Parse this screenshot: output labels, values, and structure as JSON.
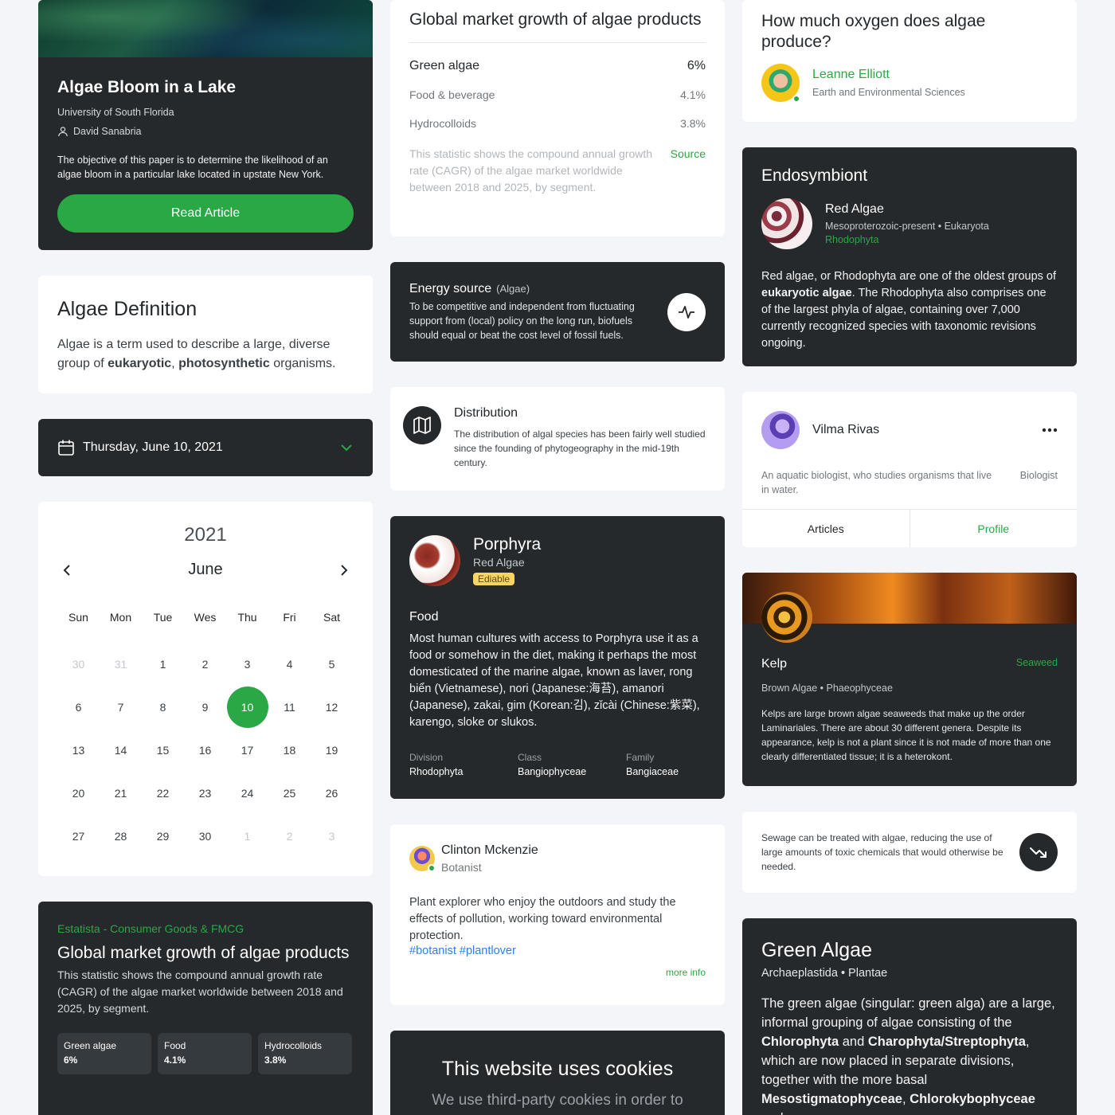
{
  "bloom": {
    "title": "Algae Bloom in a Lake",
    "university": "University of South Florida",
    "author": "David Sanabria",
    "desc": "The objective of this paper is to determine the likelihood of an algae bloom in a particular lake located in upstate New York.",
    "button": "Read Article"
  },
  "definition": {
    "title": "Algae Definition",
    "text_1": "Algae is a term used to describe a large, diverse group of ",
    "bold_1": "eukaryotic",
    "text_2": ", ",
    "bold_2": "photosynthetic",
    "text_3": " organisms."
  },
  "date_picker": {
    "label": "Thursday, June 10, 2021"
  },
  "calendar": {
    "year": "2021",
    "month": "June",
    "weekdays": [
      "Sun",
      "Mon",
      "Tue",
      "Wes",
      "Thu",
      "Fri",
      "Sat"
    ],
    "days": [
      "30",
      "31",
      "1",
      "2",
      "3",
      "4",
      "5",
      "6",
      "7",
      "8",
      "9",
      "10",
      "11",
      "12",
      "13",
      "14",
      "15",
      "16",
      "17",
      "18",
      "19",
      "20",
      "21",
      "22",
      "23",
      "24",
      "25",
      "26",
      "27",
      "28",
      "29",
      "30",
      "1",
      "2",
      "3"
    ],
    "outside_indexes": [
      0,
      1,
      32,
      33,
      34
    ],
    "selected_index": 11
  },
  "stat_dark": {
    "source": "Estatista - Consumer Goods & FMCG",
    "title": "Global market growth of algae products",
    "desc": "This statistic shows the compound annual growth rate (CAGR) of the algae market worldwide between 2018 and 2025, by segment.",
    "pills": [
      {
        "label": "Green algae",
        "value": "6%"
      },
      {
        "label": "Food",
        "value": "4.1%"
      },
      {
        "label": "Hydrocolloids",
        "value": "3.8%"
      }
    ]
  },
  "growth": {
    "title": "Global market growth of algae products",
    "main_label": "Green algae",
    "main_value": "6%",
    "rows": [
      {
        "label": "Food & beverage",
        "value": "4.1%"
      },
      {
        "label": "Hydrocolloids",
        "value": "3.8%"
      }
    ],
    "note": "This statistic shows the compound annual growth rate (CAGR) of the algae market worldwide between 2018 and 2025, by segment.",
    "link": "Source"
  },
  "energy": {
    "title": "Energy source",
    "tag": "(Algae)",
    "desc": "To be competitive and independent from fluctuating support from (local) policy on the long run, biofuels should equal or beat the cost level of fossil fuels.",
    "icon": "activity-icon"
  },
  "distribution": {
    "title": "Distribution",
    "desc": "The distribution of algal species has been fairly well studied since the founding of phytogeography in the mid-19th century.",
    "icon": "map-icon"
  },
  "porphyra": {
    "title": "Porphyra",
    "type": "Red Algae",
    "badge": "Ediable",
    "section": "Food",
    "desc": "Most human cultures with access to Porphyra use it as a food or somehow in the diet, making it perhaps the most domesticated of the marine algae, known as laver, rong biển (Vietnamese), nori (Japanese:海苔), amanori (Japanese), zakai, gim (Korean:김), zǐcài (Chinese:紫菜), karengo, sloke or slukos.",
    "taxonomy": [
      {
        "key": "Division",
        "value": "Rhodophyta"
      },
      {
        "key": "Class",
        "value": "Bangiophyceae"
      },
      {
        "key": "Family",
        "value": "Bangiaceae"
      }
    ]
  },
  "clinton": {
    "name": "Clinton Mckenzie",
    "role": "Botanist",
    "bio": "Plant explorer who enjoy the outdoors and study the effects of pollution, working toward environmental protection.",
    "tags": "#botanist #plantlover",
    "more": "more info"
  },
  "cookies": {
    "title": "This website uses cookies",
    "text": "We use third-party cookies in order to"
  },
  "oxygen": {
    "title": "How much oxygen does algae produce?",
    "name": "Leanne Elliott",
    "dept": "Earth and Environmental Sciences"
  },
  "endo": {
    "title": "Endosymbiont",
    "name": "Red Algae",
    "meta": "Mesoproterozoic-present • Eukaryota",
    "phylum": "Rhodophyta",
    "text_1": "Red algae, or Rhodophyta are one of the oldest groups of ",
    "bold_1": "eukaryotic algae",
    "text_2": ". The Rhodophyta also comprises one of the largest phyla of algae, containing over 7,000 currently recognized species with taxonomic revisions ongoing."
  },
  "vilma": {
    "name": "Vilma Rivas",
    "desc": "An aquatic biologist, who studies organisms that live in water.",
    "role": "Biologist",
    "tab_1": "Articles",
    "tab_2": "Profile"
  },
  "kelp": {
    "title": "Kelp",
    "tag": "Seaweed",
    "meta": "Brown Algae • Phaeophyceae",
    "desc": "Kelps are large brown algae seaweeds that make up the order Laminariales. There are about 30 different genera. Despite its appearance, kelp is not a plant since it is not made of more than one clearly differentiated tissue; it is a heterokont."
  },
  "sewage": {
    "text": "Sewage can be treated with algae, reducing the use of large amounts of toxic chemicals that would otherwise be needed.",
    "icon": "trending-down-icon"
  },
  "green": {
    "title": "Green Algae",
    "meta": "Archaeplastida • Plantae",
    "text_1": "The green algae (singular: green alga) are a large, informal grouping of algae consisting of the ",
    "bold_1": "Chlorophyta",
    "text_2": " and ",
    "bold_2": "Charophyta/Streptophyta",
    "text_3": ", which are now placed in separate divisions, together with the more basal ",
    "bold_3": "Mesostigmatophyceae",
    "text_4": ", ",
    "bold_4": "Chlorokybophyceae",
    "text_5": " and"
  }
}
